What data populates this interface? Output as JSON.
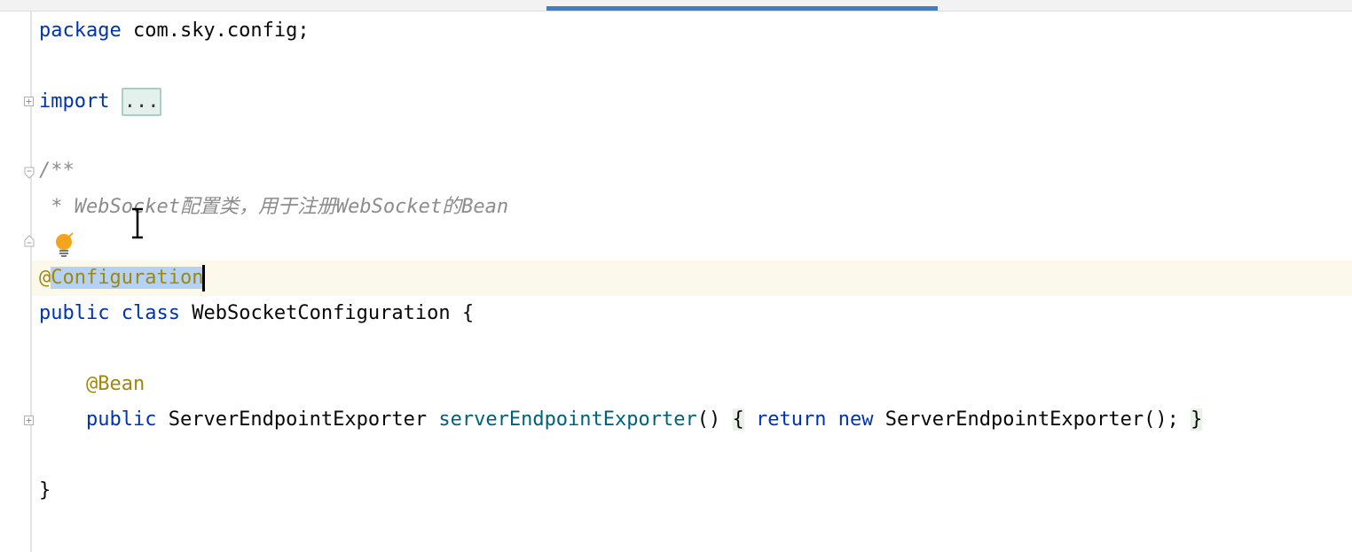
{
  "editor": {
    "colors": {
      "keyword": "#0033b3",
      "comment": "#8c8c8c",
      "annotation": "#9e880d",
      "method": "#00627a",
      "selection": "#b5d2f5",
      "current_line": "#fdf9ea",
      "tab_indicator": "#3d7ecf"
    },
    "lines": {
      "package_keyword": "package",
      "package_name": " com.sky.config;",
      "import_keyword": "import",
      "import_folded": "...",
      "javadoc_open": "/**",
      "javadoc_text": " * WebSocket配置类，用于注册WebSocket的Bean",
      "annotation_at": "@",
      "annotation_selected": "Configuration",
      "class_public": "public",
      "class_keyword": "class",
      "class_name": " WebSocketConfiguration {",
      "bean_annotation": "@Bean",
      "method_public": "public",
      "method_return_type": " ServerEndpointExporter ",
      "method_name": "serverEndpointExporter",
      "method_parens": "() ",
      "body_open": "{",
      "body_return": "return",
      "body_new": "new",
      "body_rest": " ServerEndpointExporter(); ",
      "body_close": "}",
      "class_close": "}"
    },
    "gutter_icons": [
      "fold-expand-icon",
      "fold-collapse-icon",
      "lightbulb-icon"
    ]
  }
}
